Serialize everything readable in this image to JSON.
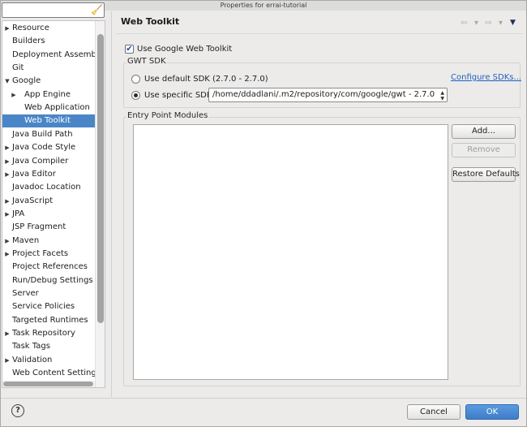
{
  "window": {
    "title": "Properties for errai-tutorial"
  },
  "filter": {
    "value": ""
  },
  "tree": {
    "items": [
      {
        "label": "Resource",
        "expandable": true,
        "level": 0,
        "selected": false
      },
      {
        "label": "Builders",
        "expandable": false,
        "level": 0,
        "selected": false
      },
      {
        "label": "Deployment Assembly",
        "expandable": false,
        "level": 0,
        "selected": false
      },
      {
        "label": "Git",
        "expandable": false,
        "level": 0,
        "selected": false
      },
      {
        "label": "Google",
        "expandable": true,
        "expanded": true,
        "level": 0,
        "selected": false
      },
      {
        "label": "App Engine",
        "expandable": true,
        "level": 1,
        "selected": false
      },
      {
        "label": "Web Application",
        "expandable": false,
        "level": 1,
        "selected": false
      },
      {
        "label": "Web Toolkit",
        "expandable": false,
        "level": 1,
        "selected": true
      },
      {
        "label": "Java Build Path",
        "expandable": false,
        "level": 0,
        "selected": false
      },
      {
        "label": "Java Code Style",
        "expandable": true,
        "level": 0,
        "selected": false
      },
      {
        "label": "Java Compiler",
        "expandable": true,
        "level": 0,
        "selected": false
      },
      {
        "label": "Java Editor",
        "expandable": true,
        "level": 0,
        "selected": false
      },
      {
        "label": "Javadoc Location",
        "expandable": false,
        "level": 0,
        "selected": false
      },
      {
        "label": "JavaScript",
        "expandable": true,
        "level": 0,
        "selected": false
      },
      {
        "label": "JPA",
        "expandable": true,
        "level": 0,
        "selected": false
      },
      {
        "label": "JSP Fragment",
        "expandable": false,
        "level": 0,
        "selected": false
      },
      {
        "label": "Maven",
        "expandable": true,
        "level": 0,
        "selected": false
      },
      {
        "label": "Project Facets",
        "expandable": true,
        "level": 0,
        "selected": false
      },
      {
        "label": "Project References",
        "expandable": false,
        "level": 0,
        "selected": false
      },
      {
        "label": "Run/Debug Settings",
        "expandable": false,
        "level": 0,
        "selected": false
      },
      {
        "label": "Server",
        "expandable": false,
        "level": 0,
        "selected": false
      },
      {
        "label": "Service Policies",
        "expandable": false,
        "level": 0,
        "selected": false
      },
      {
        "label": "Targeted Runtimes",
        "expandable": false,
        "level": 0,
        "selected": false
      },
      {
        "label": "Task Repository",
        "expandable": true,
        "level": 0,
        "selected": false
      },
      {
        "label": "Task Tags",
        "expandable": false,
        "level": 0,
        "selected": false
      },
      {
        "label": "Validation",
        "expandable": true,
        "level": 0,
        "selected": false
      },
      {
        "label": "Web Content Settings",
        "expandable": false,
        "level": 0,
        "selected": false
      }
    ]
  },
  "page": {
    "title": "Web Toolkit",
    "use_gwt_label": "Use Google Web Toolkit",
    "use_gwt_checked": true
  },
  "sdk": {
    "group_label": "GWT SDK",
    "default_label": "Use default SDK (2.7.0 - 2.7.0)",
    "specific_label": "Use specific SDK:",
    "selected_option": "specific",
    "configure_link": "Configure SDKs...",
    "specific_value": "/home/ddadlani/.m2/repository/com/google/gwt - 2.7.0"
  },
  "modules": {
    "group_label": "Entry Point Modules",
    "add_label": "Add...",
    "remove_label": "Remove",
    "restore_label": "Restore Defaults"
  },
  "footer": {
    "cancel_label": "Cancel",
    "ok_label": "OK"
  },
  "icons": {
    "expand": "triangle-right-icon",
    "collapse": "triangle-down-icon",
    "filter_clear": "broom-icon",
    "help": "help-icon",
    "nav_back": "back-arrow-icon",
    "nav_forward": "forward-arrow-icon",
    "view_menu": "view-menu-icon"
  }
}
